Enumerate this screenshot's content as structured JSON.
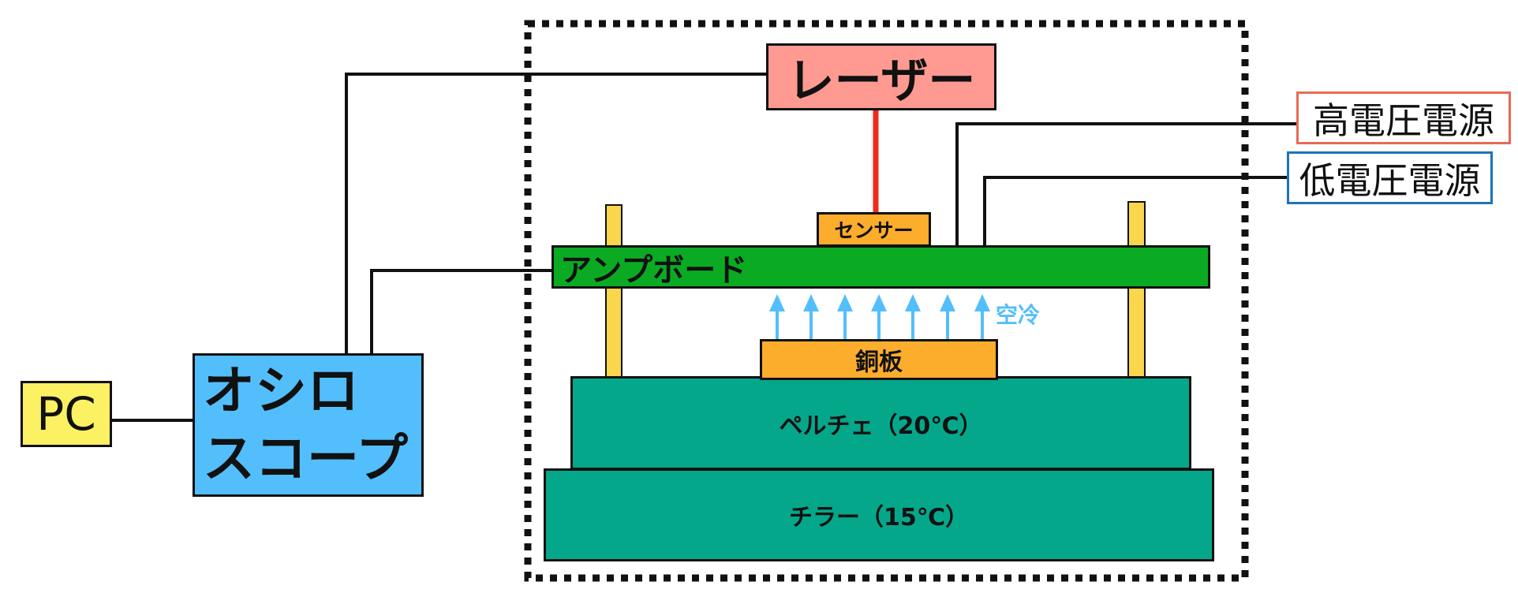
{
  "labels": {
    "pc": "PC",
    "oscilloscope_line1": "オシロ",
    "oscilloscope_line2": "スコープ",
    "laser": "レーザー",
    "high_voltage": "高電圧電源",
    "low_voltage": "低電圧電源",
    "sensor": "センサー",
    "amp_board": "アンプボード",
    "air_cooling": "空冷",
    "copper_plate": "銅板",
    "peltier": "ペルチェ（20℃）",
    "chiller": "チラー（15℃）"
  },
  "colors": {
    "pc": "#fbf163",
    "oscilloscope": "#53befc",
    "laser": "#fe9a92",
    "laser_beam": "#ee2a1a",
    "high_voltage_border": "#e86a57",
    "low_voltage_border": "#1e73b8",
    "amp_board": "#0aab23",
    "sensor": "#fcad2c",
    "copper": "#fcad2c",
    "peltier": "#05a78b",
    "chiller": "#05a78b",
    "posts": "#f9d64b",
    "air_arrows": "#53befc"
  }
}
